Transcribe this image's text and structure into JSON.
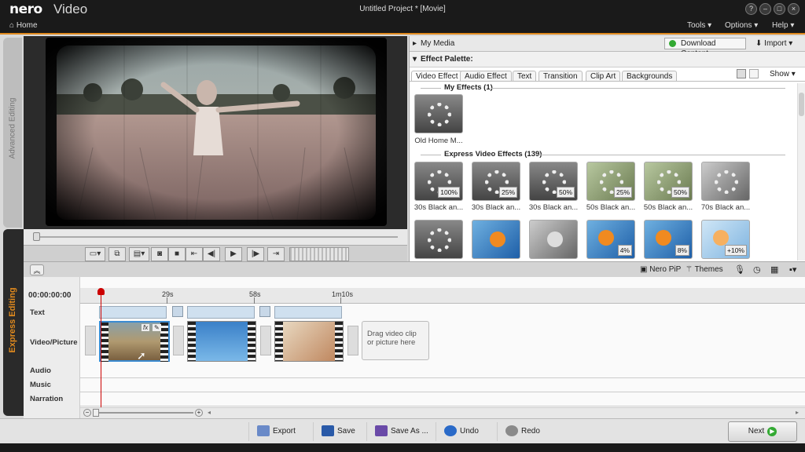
{
  "app": {
    "logo": "nero",
    "name": "Video",
    "window_title": "Untitled Project * [Movie]"
  },
  "window_buttons": [
    "?",
    "–",
    "□",
    "×"
  ],
  "menubar": {
    "home": "Home",
    "items": [
      "Tools ▾",
      "Options ▾",
      "Help ▾"
    ]
  },
  "side_tabs": {
    "advanced": "Advanced Editing",
    "express": "Express Editing"
  },
  "media": {
    "my_media": "My Media",
    "download": "Download Content",
    "import": "Import ▾",
    "palette_title": "Effect Palette:",
    "tabs": [
      "Video Effect",
      "Audio Effect",
      "Text",
      "Transition",
      "Clip Art",
      "Backgrounds"
    ],
    "show": "Show ▾",
    "my_effects_title": "My Effects (1)",
    "my_effects": [
      {
        "label": "Old Home M..."
      }
    ],
    "express_title": "Express Video Effects (139)",
    "row1": [
      {
        "label": "30s Black an...",
        "pct": "100%"
      },
      {
        "label": "30s Black an...",
        "pct": "25%"
      },
      {
        "label": "30s Black an...",
        "pct": "50%"
      },
      {
        "label": "50s Black an...",
        "pct": "25%"
      },
      {
        "label": "50s Black an...",
        "pct": "50%"
      },
      {
        "label": "70s Black an...",
        "pct": ""
      }
    ],
    "row2": [
      {
        "pct": ""
      },
      {
        "pct": ""
      },
      {
        "pct": ""
      },
      {
        "pct": "4%"
      },
      {
        "pct": "8%"
      },
      {
        "pct": "+10%"
      }
    ]
  },
  "tl_toolbar": {
    "pip": "Nero PiP",
    "themes": "Themes"
  },
  "timeline": {
    "timecode": "00:00:00:00",
    "ruler": [
      "29s",
      "58s",
      "1m10s"
    ],
    "tracks": [
      "Text",
      "Video/Picture",
      "Audio",
      "Music",
      "Narration"
    ],
    "dropzone": "Drag video clip or picture here",
    "clip_fx": "fx"
  },
  "bottom": {
    "export": "Export",
    "save": "Save",
    "save_as": "Save As ...",
    "undo": "Undo",
    "redo": "Redo",
    "next": "Next"
  }
}
